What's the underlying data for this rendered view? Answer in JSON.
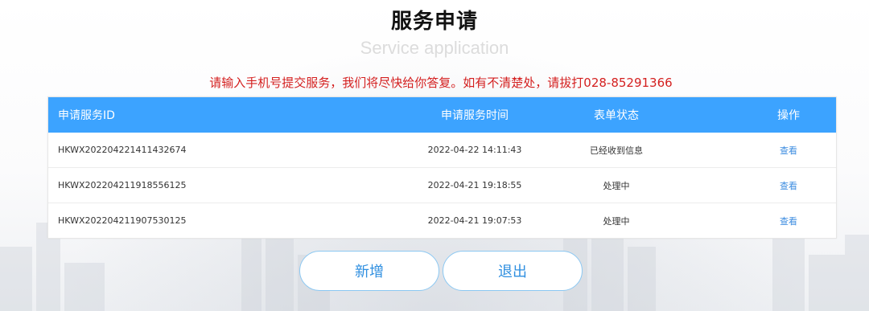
{
  "page": {
    "title": "服务申请",
    "subtitle": "Service application",
    "notice": "请输入手机号提交服务，我们将尽快给你答复。如有不清楚处，请拔打028-85291366"
  },
  "table": {
    "headers": {
      "id": "申请服务ID",
      "time": "申请服务时间",
      "status": "表单状态",
      "action": "操作"
    },
    "rows": [
      {
        "id": "HKWX202204221411432674",
        "time": "2022-04-22 14:11:43",
        "status": "已经收到信息",
        "action": "查看"
      },
      {
        "id": "HKWX202204211918556125",
        "time": "2022-04-21 19:18:55",
        "status": "处理中",
        "action": "查看"
      },
      {
        "id": "HKWX202204211907530125",
        "time": "2022-04-21 19:07:53",
        "status": "处理中",
        "action": "查看"
      }
    ]
  },
  "buttons": {
    "add": "新增",
    "exit": "退出"
  },
  "colors": {
    "header_bg": "#3ca3ff",
    "notice": "#d42020",
    "link": "#3c8ce0",
    "button_text": "#2f8fe0"
  }
}
